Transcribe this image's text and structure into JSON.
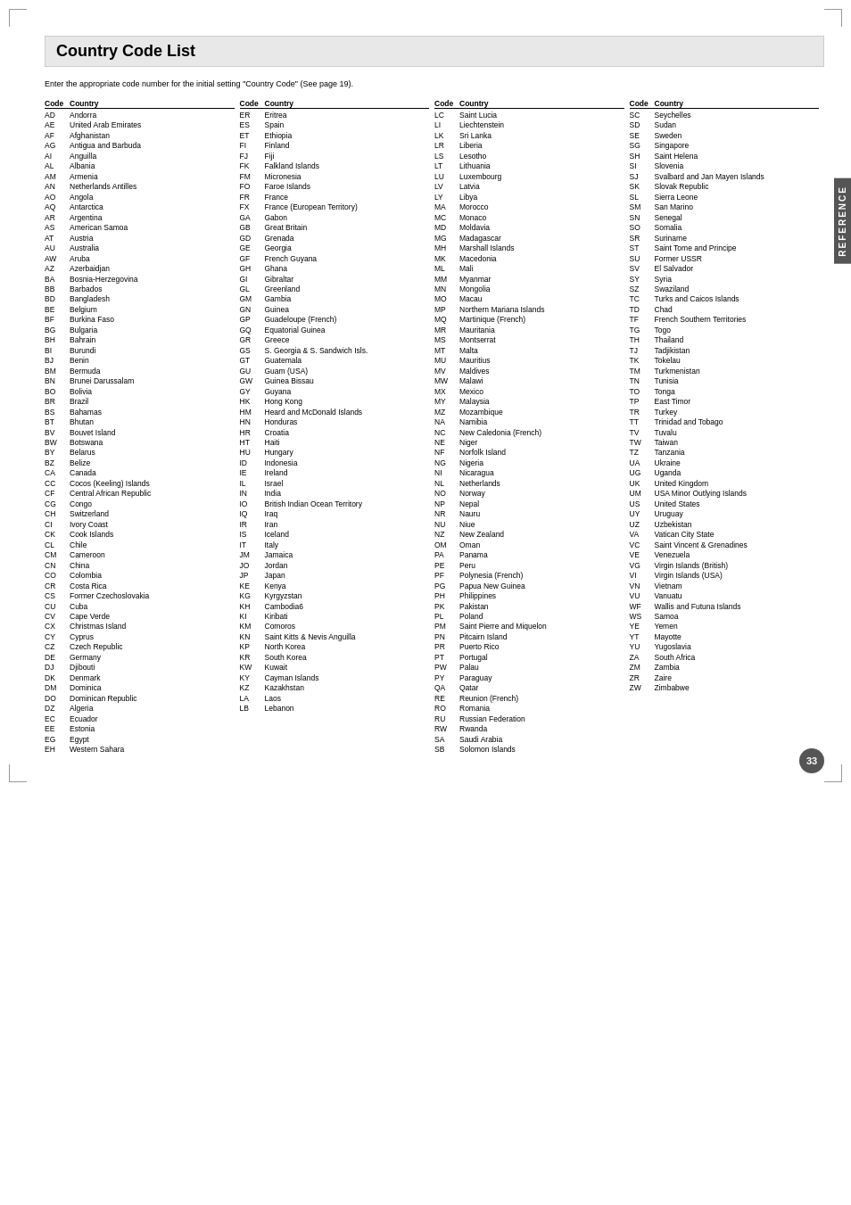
{
  "page": {
    "title": "Country Code List",
    "subtitle": "Enter the appropriate code number for the initial setting \"Country Code\" (See page 19).",
    "page_number": "33",
    "reference_tab": "REFERENCE"
  },
  "columns": [
    {
      "header_code": "Code",
      "header_country": "Country",
      "entries": [
        {
          "code": "AD",
          "country": "Andorra"
        },
        {
          "code": "AE",
          "country": "United Arab Emirates"
        },
        {
          "code": "AF",
          "country": "Afghanistan"
        },
        {
          "code": "AG",
          "country": "Antigua and Barbuda"
        },
        {
          "code": "AI",
          "country": "Anguilla"
        },
        {
          "code": "AL",
          "country": "Albania"
        },
        {
          "code": "AM",
          "country": "Armenia"
        },
        {
          "code": "AN",
          "country": "Netherlands Antilles"
        },
        {
          "code": "AO",
          "country": "Angola"
        },
        {
          "code": "AQ",
          "country": "Antarctica"
        },
        {
          "code": "AR",
          "country": "Argentina"
        },
        {
          "code": "AS",
          "country": "American Samoa"
        },
        {
          "code": "AT",
          "country": "Austria"
        },
        {
          "code": "AU",
          "country": "Australia"
        },
        {
          "code": "AW",
          "country": "Aruba"
        },
        {
          "code": "AZ",
          "country": "Azerbaidjan"
        },
        {
          "code": "BA",
          "country": "Bosnia-Herzegovina"
        },
        {
          "code": "BB",
          "country": "Barbados"
        },
        {
          "code": "BD",
          "country": "Bangladesh"
        },
        {
          "code": "BE",
          "country": "Belgium"
        },
        {
          "code": "BF",
          "country": "Burkina Faso"
        },
        {
          "code": "BG",
          "country": "Bulgaria"
        },
        {
          "code": "BH",
          "country": "Bahrain"
        },
        {
          "code": "BI",
          "country": "Burundi"
        },
        {
          "code": "BJ",
          "country": "Benin"
        },
        {
          "code": "BM",
          "country": "Bermuda"
        },
        {
          "code": "BN",
          "country": "Brunei Darussalam"
        },
        {
          "code": "BO",
          "country": "Bolivia"
        },
        {
          "code": "BR",
          "country": "Brazil"
        },
        {
          "code": "BS",
          "country": "Bahamas"
        },
        {
          "code": "BT",
          "country": "Bhutan"
        },
        {
          "code": "BV",
          "country": "Bouvet Island"
        },
        {
          "code": "BW",
          "country": "Botswana"
        },
        {
          "code": "BY",
          "country": "Belarus"
        },
        {
          "code": "BZ",
          "country": "Belize"
        },
        {
          "code": "CA",
          "country": "Canada"
        },
        {
          "code": "CC",
          "country": "Cocos (Keeling) Islands"
        },
        {
          "code": "CF",
          "country": "Central African Republic"
        },
        {
          "code": "CG",
          "country": "Congo"
        },
        {
          "code": "CH",
          "country": "Switzerland"
        },
        {
          "code": "CI",
          "country": "Ivory Coast"
        },
        {
          "code": "CK",
          "country": "Cook Islands"
        },
        {
          "code": "CL",
          "country": "Chile"
        },
        {
          "code": "CM",
          "country": "Cameroon"
        },
        {
          "code": "CN",
          "country": "China"
        },
        {
          "code": "CO",
          "country": "Colombia"
        },
        {
          "code": "CR",
          "country": "Costa Rica"
        },
        {
          "code": "CS",
          "country": "Former Czechoslovakia"
        },
        {
          "code": "CU",
          "country": "Cuba"
        },
        {
          "code": "CV",
          "country": "Cape Verde"
        },
        {
          "code": "CX",
          "country": "Christmas Island"
        },
        {
          "code": "CY",
          "country": "Cyprus"
        },
        {
          "code": "CZ",
          "country": "Czech Republic"
        },
        {
          "code": "DE",
          "country": "Germany"
        },
        {
          "code": "DJ",
          "country": "Djibouti"
        },
        {
          "code": "DK",
          "country": "Denmark"
        },
        {
          "code": "DM",
          "country": "Dominica"
        },
        {
          "code": "DO",
          "country": "Dominican Republic"
        },
        {
          "code": "DZ",
          "country": "Algeria"
        },
        {
          "code": "EC",
          "country": "Ecuador"
        },
        {
          "code": "EE",
          "country": "Estonia"
        },
        {
          "code": "EG",
          "country": "Egypt"
        },
        {
          "code": "EH",
          "country": "Western Sahara"
        }
      ]
    },
    {
      "header_code": "Code",
      "header_country": "Country",
      "entries": [
        {
          "code": "ER",
          "country": "Eritrea"
        },
        {
          "code": "ES",
          "country": "Spain"
        },
        {
          "code": "ET",
          "country": "Ethiopia"
        },
        {
          "code": "FI",
          "country": "Finland"
        },
        {
          "code": "FJ",
          "country": "Fiji"
        },
        {
          "code": "FK",
          "country": "Falkland Islands"
        },
        {
          "code": "FM",
          "country": "Micronesia"
        },
        {
          "code": "FO",
          "country": "Faroe Islands"
        },
        {
          "code": "FR",
          "country": "France"
        },
        {
          "code": "FX",
          "country": "France (European Territory)"
        },
        {
          "code": "GA",
          "country": "Gabon"
        },
        {
          "code": "GB",
          "country": "Great Britain"
        },
        {
          "code": "GD",
          "country": "Grenada"
        },
        {
          "code": "GE",
          "country": "Georgia"
        },
        {
          "code": "GF",
          "country": "French Guyana"
        },
        {
          "code": "GH",
          "country": "Ghana"
        },
        {
          "code": "GI",
          "country": "Gibraltar"
        },
        {
          "code": "GL",
          "country": "Greenland"
        },
        {
          "code": "GM",
          "country": "Gambia"
        },
        {
          "code": "GN",
          "country": "Guinea"
        },
        {
          "code": "GP",
          "country": "Guadeloupe (French)"
        },
        {
          "code": "GQ",
          "country": "Equatorial Guinea"
        },
        {
          "code": "GR",
          "country": "Greece"
        },
        {
          "code": "GS",
          "country": "S. Georgia & S. Sandwich Isls."
        },
        {
          "code": "GT",
          "country": "Guatemala"
        },
        {
          "code": "GU",
          "country": "Guam (USA)"
        },
        {
          "code": "GW",
          "country": "Guinea Bissau"
        },
        {
          "code": "GY",
          "country": "Guyana"
        },
        {
          "code": "HK",
          "country": "Hong Kong"
        },
        {
          "code": "HM",
          "country": "Heard and McDonald Islands"
        },
        {
          "code": "HN",
          "country": "Honduras"
        },
        {
          "code": "HR",
          "country": "Croatia"
        },
        {
          "code": "HT",
          "country": "Haiti"
        },
        {
          "code": "HU",
          "country": "Hungary"
        },
        {
          "code": "ID",
          "country": "Indonesia"
        },
        {
          "code": "IE",
          "country": "Ireland"
        },
        {
          "code": "IL",
          "country": "Israel"
        },
        {
          "code": "IN",
          "country": "India"
        },
        {
          "code": "IO",
          "country": "British Indian Ocean Territory"
        },
        {
          "code": "IQ",
          "country": "Iraq"
        },
        {
          "code": "IR",
          "country": "Iran"
        },
        {
          "code": "IS",
          "country": "Iceland"
        },
        {
          "code": "IT",
          "country": "Italy"
        },
        {
          "code": "JM",
          "country": "Jamaica"
        },
        {
          "code": "JO",
          "country": "Jordan"
        },
        {
          "code": "JP",
          "country": "Japan"
        },
        {
          "code": "KE",
          "country": "Kenya"
        },
        {
          "code": "KG",
          "country": "Kyrgyzstan"
        },
        {
          "code": "KH",
          "country": "Cambodia6"
        },
        {
          "code": "KI",
          "country": "Kiribati"
        },
        {
          "code": "KM",
          "country": "Comoros"
        },
        {
          "code": "KN",
          "country": "Saint Kitts & Nevis Anguilla"
        },
        {
          "code": "KP",
          "country": "North Korea"
        },
        {
          "code": "KR",
          "country": "South Korea"
        },
        {
          "code": "KW",
          "country": "Kuwait"
        },
        {
          "code": "KY",
          "country": "Cayman Islands"
        },
        {
          "code": "KZ",
          "country": "Kazakhstan"
        },
        {
          "code": "LA",
          "country": "Laos"
        },
        {
          "code": "LB",
          "country": "Lebanon"
        }
      ]
    },
    {
      "header_code": "Code",
      "header_country": "Country",
      "entries": [
        {
          "code": "LC",
          "country": "Saint Lucia"
        },
        {
          "code": "LI",
          "country": "Liechtenstein"
        },
        {
          "code": "LK",
          "country": "Sri Lanka"
        },
        {
          "code": "LR",
          "country": "Liberia"
        },
        {
          "code": "LS",
          "country": "Lesotho"
        },
        {
          "code": "LT",
          "country": "Lithuania"
        },
        {
          "code": "LU",
          "country": "Luxembourg"
        },
        {
          "code": "LV",
          "country": "Latvia"
        },
        {
          "code": "LY",
          "country": "Libya"
        },
        {
          "code": "MA",
          "country": "Morocco"
        },
        {
          "code": "MC",
          "country": "Monaco"
        },
        {
          "code": "MD",
          "country": "Moldavia"
        },
        {
          "code": "MG",
          "country": "Madagascar"
        },
        {
          "code": "MH",
          "country": "Marshall Islands"
        },
        {
          "code": "MK",
          "country": "Macedonia"
        },
        {
          "code": "ML",
          "country": "Mali"
        },
        {
          "code": "MM",
          "country": "Myanmar"
        },
        {
          "code": "MN",
          "country": "Mongolia"
        },
        {
          "code": "MO",
          "country": "Macau"
        },
        {
          "code": "MP",
          "country": "Northern Mariana Islands"
        },
        {
          "code": "MQ",
          "country": "Martinique (French)"
        },
        {
          "code": "MR",
          "country": "Mauritania"
        },
        {
          "code": "MS",
          "country": "Montserrat"
        },
        {
          "code": "MT",
          "country": "Malta"
        },
        {
          "code": "MU",
          "country": "Mauritius"
        },
        {
          "code": "MV",
          "country": "Maldives"
        },
        {
          "code": "MW",
          "country": "Malawi"
        },
        {
          "code": "MX",
          "country": "Mexico"
        },
        {
          "code": "MY",
          "country": "Malaysia"
        },
        {
          "code": "MZ",
          "country": "Mozambique"
        },
        {
          "code": "NA",
          "country": "Namibia"
        },
        {
          "code": "NC",
          "country": "New Caledonia (French)"
        },
        {
          "code": "NE",
          "country": "Niger"
        },
        {
          "code": "NF",
          "country": "Norfolk Island"
        },
        {
          "code": "NG",
          "country": "Nigeria"
        },
        {
          "code": "NI",
          "country": "Nicaragua"
        },
        {
          "code": "NL",
          "country": "Netherlands"
        },
        {
          "code": "NO",
          "country": "Norway"
        },
        {
          "code": "NP",
          "country": "Nepal"
        },
        {
          "code": "NR",
          "country": "Nauru"
        },
        {
          "code": "NU",
          "country": "Niue"
        },
        {
          "code": "NZ",
          "country": "New Zealand"
        },
        {
          "code": "OM",
          "country": "Oman"
        },
        {
          "code": "PA",
          "country": "Panama"
        },
        {
          "code": "PE",
          "country": "Peru"
        },
        {
          "code": "PF",
          "country": "Polynesia (French)"
        },
        {
          "code": "PG",
          "country": "Papua New Guinea"
        },
        {
          "code": "PH",
          "country": "Philippines"
        },
        {
          "code": "PK",
          "country": "Pakistan"
        },
        {
          "code": "PL",
          "country": "Poland"
        },
        {
          "code": "PM",
          "country": "Saint Pierre and Miquelon"
        },
        {
          "code": "PN",
          "country": "Pitcairn Island"
        },
        {
          "code": "PR",
          "country": "Puerto Rico"
        },
        {
          "code": "PT",
          "country": "Portugal"
        },
        {
          "code": "PW",
          "country": "Palau"
        },
        {
          "code": "PY",
          "country": "Paraguay"
        },
        {
          "code": "QA",
          "country": "Qatar"
        },
        {
          "code": "RE",
          "country": "Reunion (French)"
        },
        {
          "code": "RO",
          "country": "Romania"
        },
        {
          "code": "RU",
          "country": "Russian Federation"
        },
        {
          "code": "RW",
          "country": "Rwanda"
        },
        {
          "code": "SA",
          "country": "Saudi Arabia"
        },
        {
          "code": "SB",
          "country": "Solomon Islands"
        }
      ]
    },
    {
      "header_code": "Code",
      "header_country": "Country",
      "entries": [
        {
          "code": "SC",
          "country": "Seychelles"
        },
        {
          "code": "SD",
          "country": "Sudan"
        },
        {
          "code": "SE",
          "country": "Sweden"
        },
        {
          "code": "SG",
          "country": "Singapore"
        },
        {
          "code": "SH",
          "country": "Saint Helena"
        },
        {
          "code": "SI",
          "country": "Slovenia"
        },
        {
          "code": "SJ",
          "country": "Svalbard and Jan Mayen Islands"
        },
        {
          "code": "SK",
          "country": "Slovak Republic"
        },
        {
          "code": "SL",
          "country": "Sierra Leone"
        },
        {
          "code": "SM",
          "country": "San Marino"
        },
        {
          "code": "SN",
          "country": "Senegal"
        },
        {
          "code": "SO",
          "country": "Somalia"
        },
        {
          "code": "SR",
          "country": "Suriname"
        },
        {
          "code": "ST",
          "country": "Saint Tome and Principe"
        },
        {
          "code": "SU",
          "country": "Former USSR"
        },
        {
          "code": "SV",
          "country": "El Salvador"
        },
        {
          "code": "SY",
          "country": "Syria"
        },
        {
          "code": "SZ",
          "country": "Swaziland"
        },
        {
          "code": "TC",
          "country": "Turks and Caicos Islands"
        },
        {
          "code": "TD",
          "country": "Chad"
        },
        {
          "code": "TF",
          "country": "French Southern Territories"
        },
        {
          "code": "TG",
          "country": "Togo"
        },
        {
          "code": "TH",
          "country": "Thailand"
        },
        {
          "code": "TJ",
          "country": "Tadjikistan"
        },
        {
          "code": "TK",
          "country": "Tokelau"
        },
        {
          "code": "TM",
          "country": "Turkmenistan"
        },
        {
          "code": "TN",
          "country": "Tunisia"
        },
        {
          "code": "TO",
          "country": "Tonga"
        },
        {
          "code": "TP",
          "country": "East Timor"
        },
        {
          "code": "TR",
          "country": "Turkey"
        },
        {
          "code": "TT",
          "country": "Trinidad and Tobago"
        },
        {
          "code": "TV",
          "country": "Tuvalu"
        },
        {
          "code": "TW",
          "country": "Taiwan"
        },
        {
          "code": "TZ",
          "country": "Tanzania"
        },
        {
          "code": "UA",
          "country": "Ukraine"
        },
        {
          "code": "UG",
          "country": "Uganda"
        },
        {
          "code": "UK",
          "country": "United Kingdom"
        },
        {
          "code": "UM",
          "country": "USA Minor Outlying Islands"
        },
        {
          "code": "US",
          "country": "United States"
        },
        {
          "code": "UY",
          "country": "Uruguay"
        },
        {
          "code": "UZ",
          "country": "Uzbekistan"
        },
        {
          "code": "VA",
          "country": "Vatican City State"
        },
        {
          "code": "VC",
          "country": "Saint Vincent & Grenadines"
        },
        {
          "code": "VE",
          "country": "Venezuela"
        },
        {
          "code": "VG",
          "country": "Virgin Islands (British)"
        },
        {
          "code": "VI",
          "country": "Virgin Islands (USA)"
        },
        {
          "code": "VN",
          "country": "Vietnam"
        },
        {
          "code": "VU",
          "country": "Vanuatu"
        },
        {
          "code": "WF",
          "country": "Wallis and Futuna Islands"
        },
        {
          "code": "WS",
          "country": "Samoa"
        },
        {
          "code": "YE",
          "country": "Yemen"
        },
        {
          "code": "YT",
          "country": "Mayotte"
        },
        {
          "code": "YU",
          "country": "Yugoslavia"
        },
        {
          "code": "ZA",
          "country": "South Africa"
        },
        {
          "code": "ZM",
          "country": "Zambia"
        },
        {
          "code": "ZR",
          "country": "Zaire"
        },
        {
          "code": "ZW",
          "country": "Zimbabwe"
        }
      ]
    }
  ]
}
